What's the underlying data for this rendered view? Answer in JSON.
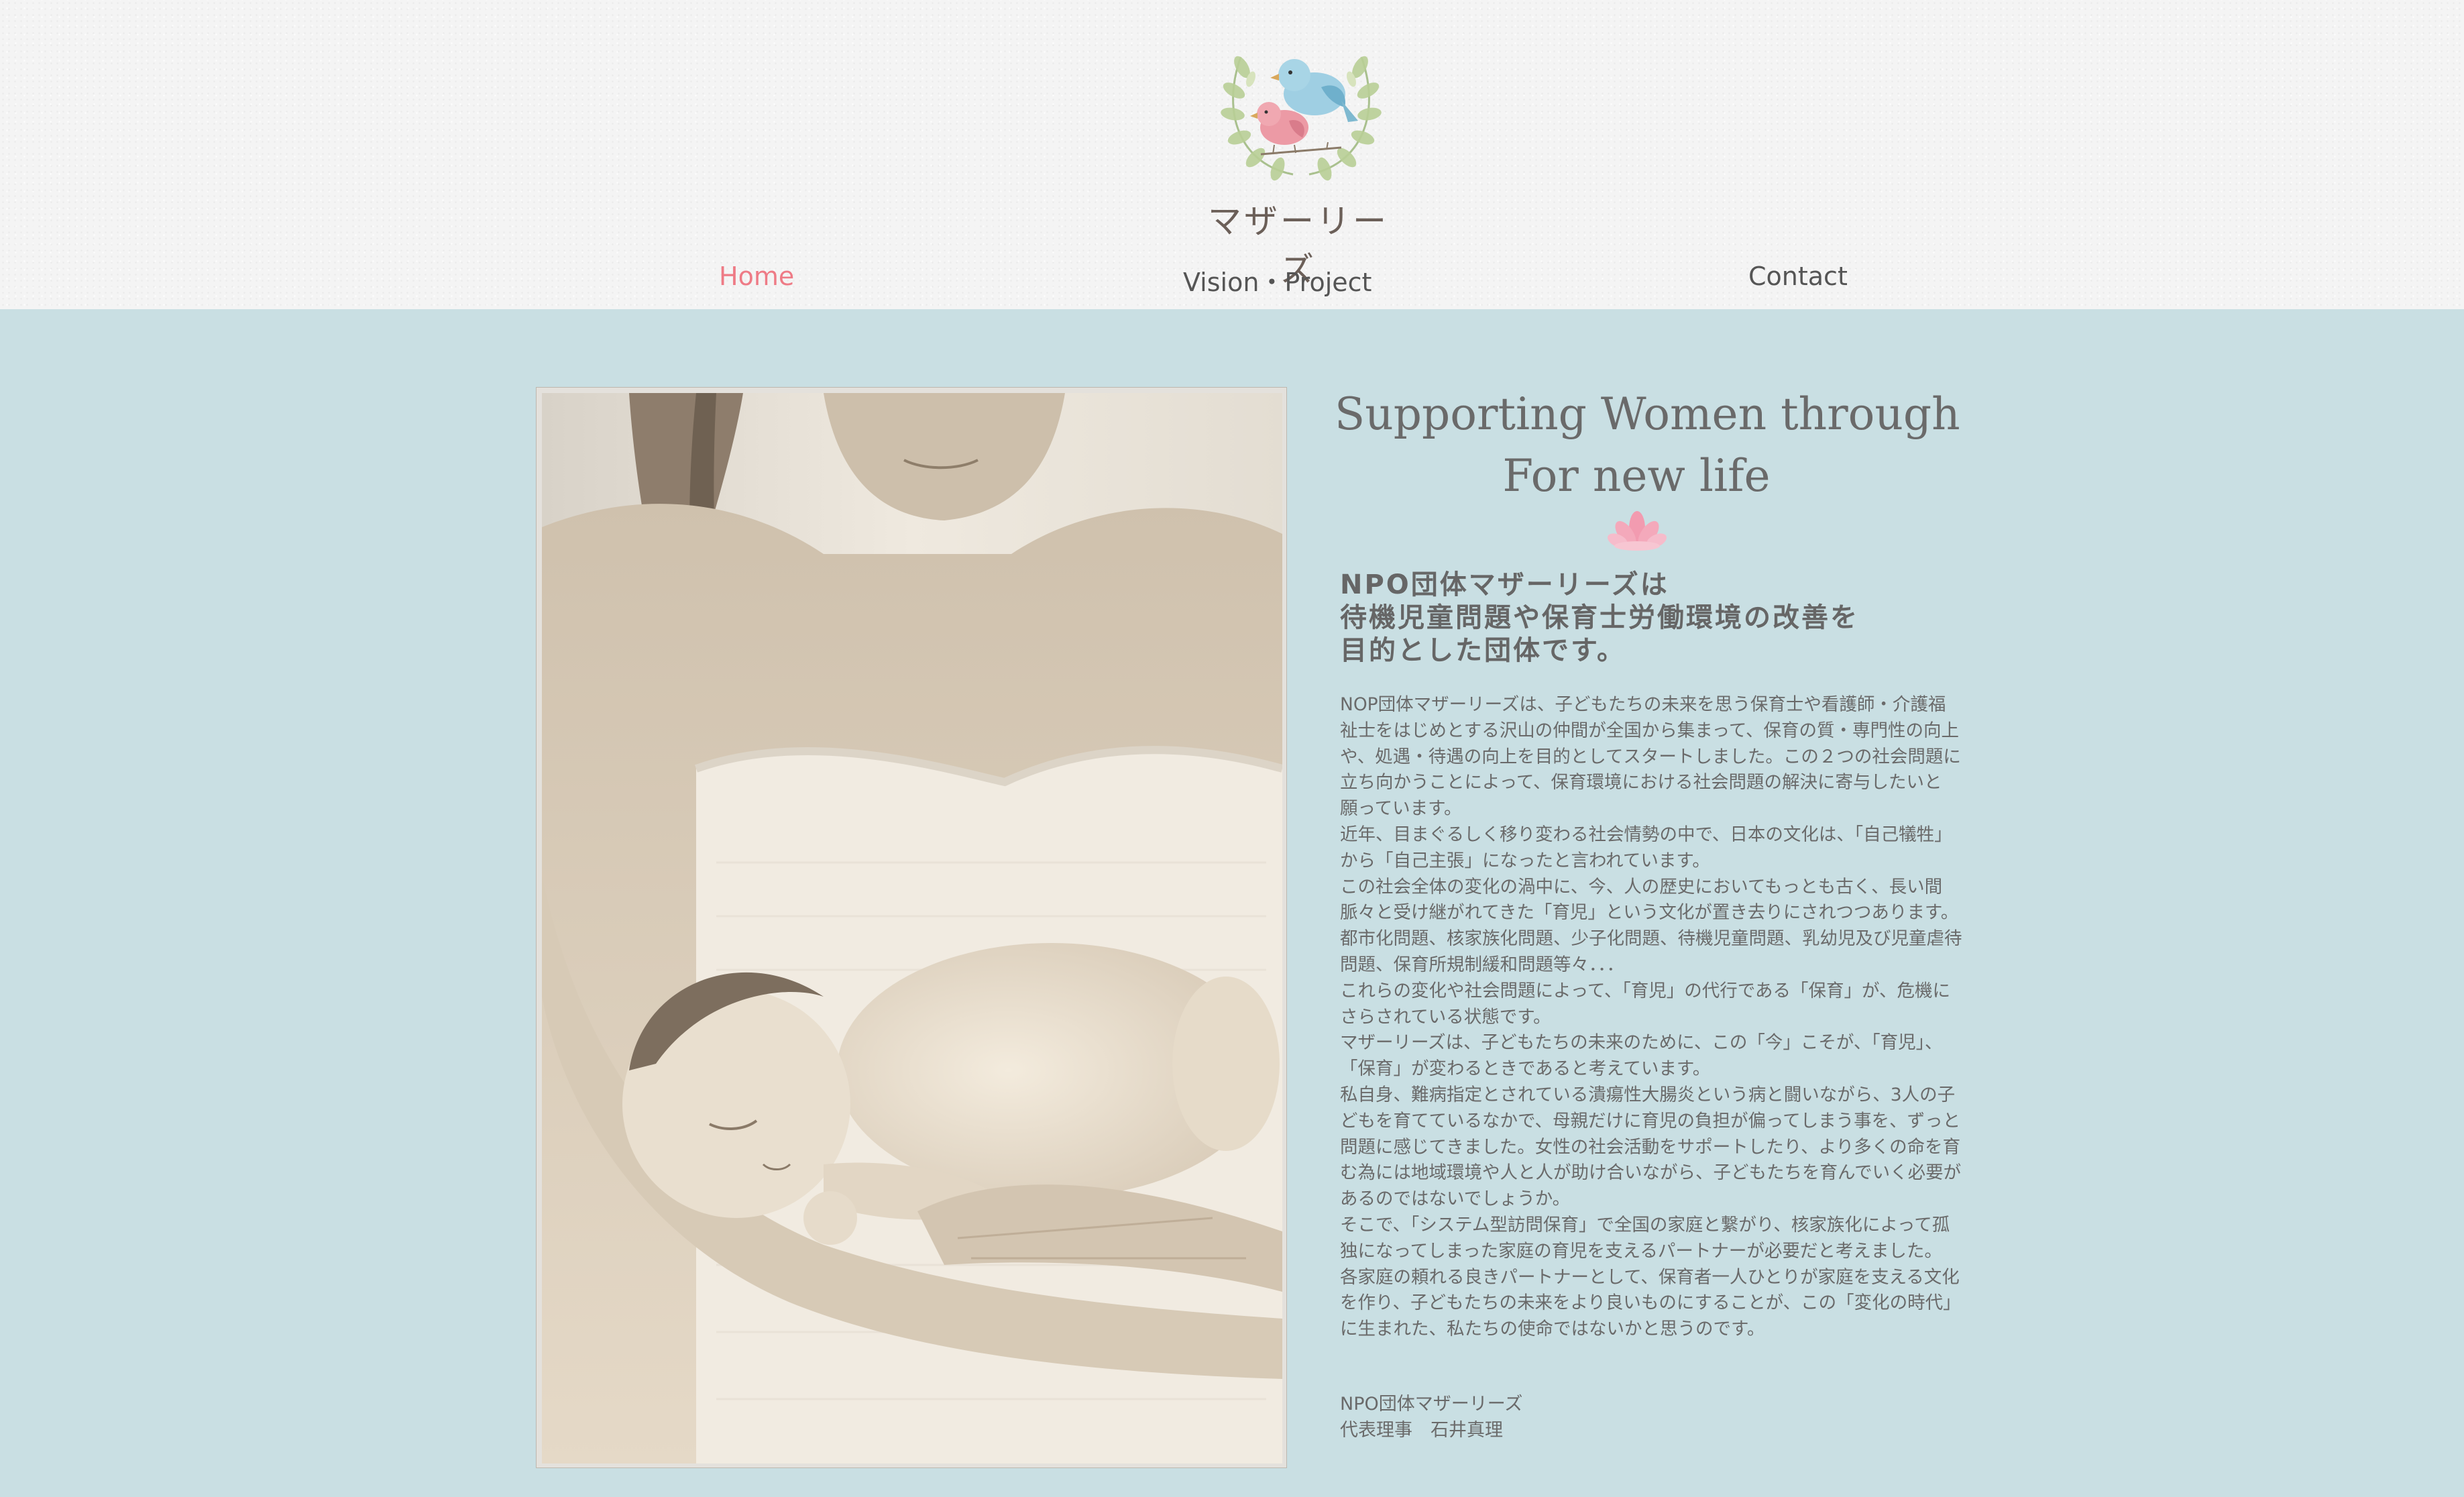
{
  "header": {
    "logo_text": "マザーリーズ"
  },
  "nav": {
    "items": [
      {
        "label": "Home",
        "active": true
      },
      {
        "label": "Vision・Project",
        "active": false
      },
      {
        "label": "Contact",
        "active": false
      }
    ]
  },
  "main": {
    "headline": [
      "Supporting Women through",
      "For new life"
    ],
    "lead": [
      "NPO団体マザーリーズは",
      "待機児童問題や保育士労働環境の改善を",
      "目的とした団体です。"
    ],
    "body_lines": [
      "NOP団体マザーリーズは、子どもたちの未来を思う保育士や看護師・介護福",
      "祉士をはじめとする沢山の仲間が全国から集まって、保育の質・専門性の向上",
      "や、処遇・待遇の向上を目的としてスタートしました。この２つの社会問題に",
      "立ち向かうことによって、保育環境における社会問題の解決に寄与したいと",
      "願っています。",
      "近年、目まぐるしく移り変わる社会情勢の中で、日本の文化は、「自己犠牲」",
      "から「自己主張」になったと言われています。",
      "この社会全体の変化の渦中に、今、人の歴史においてもっとも古く、長い間",
      "脈々と受け継がれてきた「育児」という文化が置き去りにされつつあります。",
      "都市化問題、核家族化問題、少子化問題、待機児童問題、乳幼児及び児童虐待",
      "問題、保育所規制緩和問題等々．．．",
      "これらの変化や社会問題によって、「育児」の代行である「保育」が、危機に",
      "さらされている状態です。",
      "マザーリーズは、子どもたちの未来のために、この「今」こそが、「育児」、",
      "「保育」が変わるときであると考えています。",
      "私自身、難病指定とされている潰瘍性大腸炎という病と闘いながら、3人の子",
      "どもを育てているなかで、母親だけに育児の負担が偏ってしまう事を、ずっと",
      "問題に感じてきました。女性の社会活動をサポートしたり、より多くの命を育",
      "む為には地域環境や人と人が助け合いながら、子どもたちを育んでいく必要が",
      "あるのではないでしょうか。",
      "そこで、「システム型訪問保育」で全国の家庭と繋がり、核家族化によって孤",
      "独になってしまった家庭の育児を支えるパートナーが必要だと考えました。",
      "各家庭の頼れる良きパートナーとして、保育者一人ひとりが家庭を支える文化",
      "を作り、子どもたちの未来をより良いものにすることが、この「変化の時代」",
      "に生まれた、私たちの使命ではないかと思うのです。"
    ],
    "signature": [
      "NPO団体マザーリーズ",
      "代表理事　石井真理"
    ]
  },
  "colors": {
    "header_bg": "#f4f4f4",
    "content_bg": "#c9dfe3",
    "nav_active": "#ee7b86",
    "text": "#666666"
  },
  "icons": {
    "logo": "birds-wreath-logo",
    "divider": "lotus-icon"
  }
}
